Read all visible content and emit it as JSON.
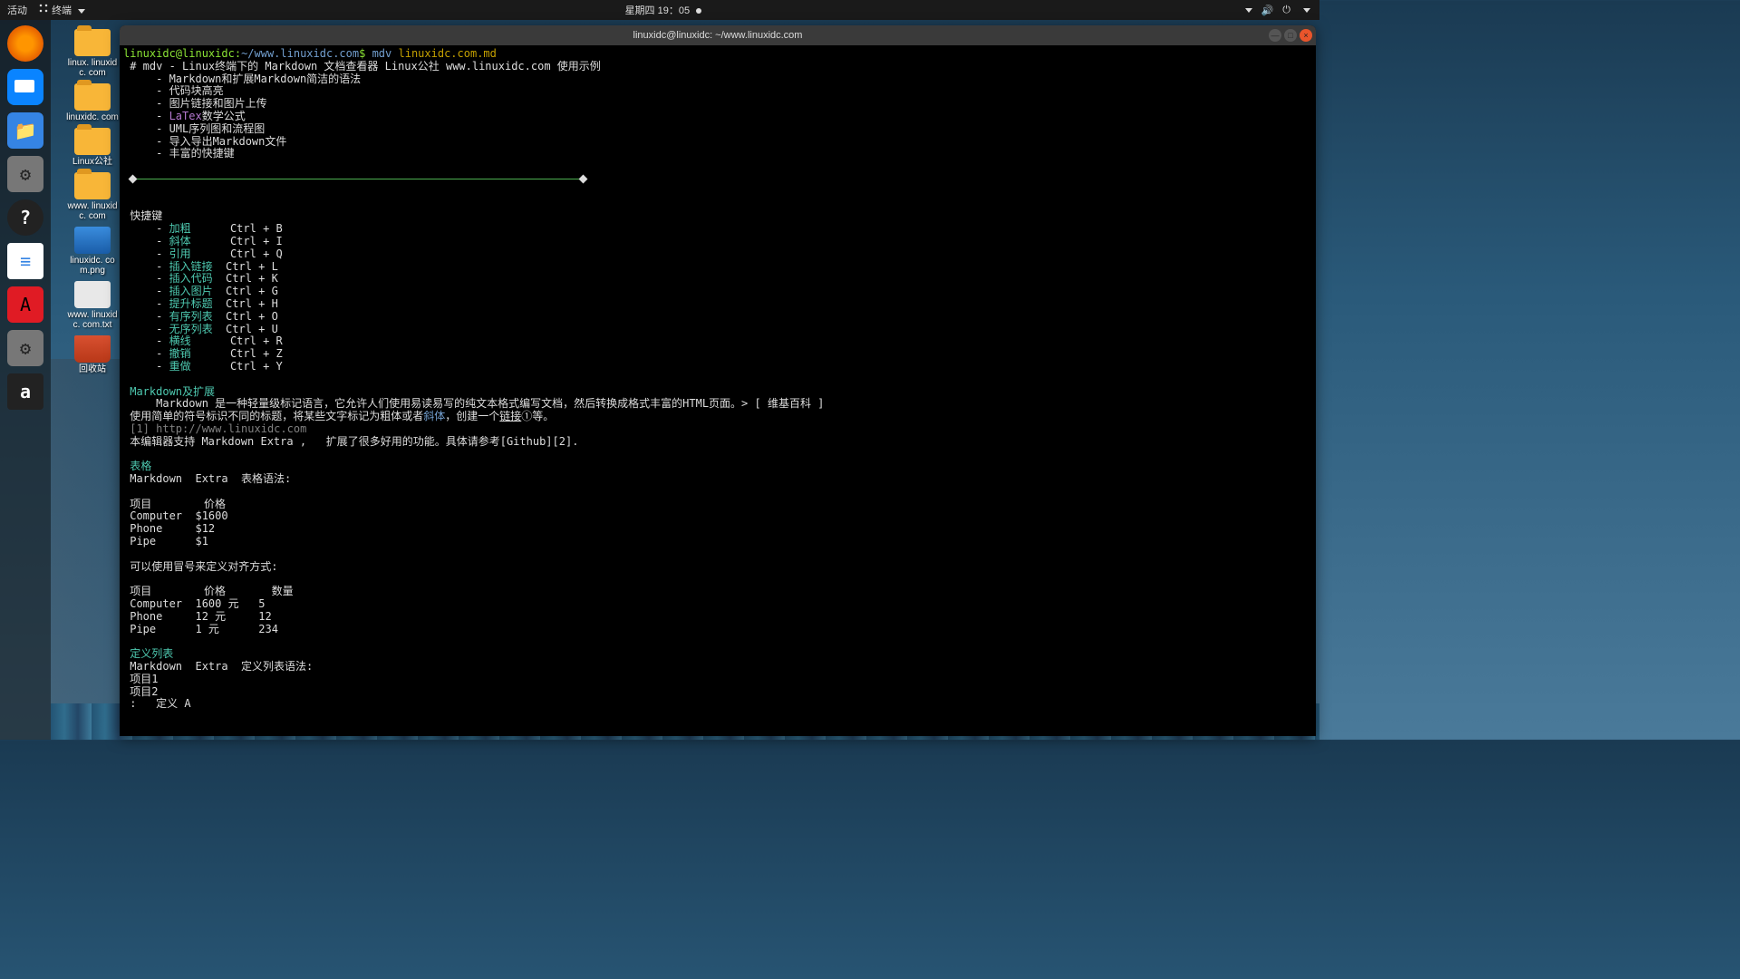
{
  "topbar": {
    "activities": "活动",
    "app_label": "终端",
    "datetime": "星期四 19：05"
  },
  "desktop_icons": [
    {
      "label": "linux.\nlinuxidc.\ncom",
      "kind": "folder"
    },
    {
      "label": "linuxidc.\ncom",
      "kind": "folder"
    },
    {
      "label": "Linux公社",
      "kind": "folder"
    },
    {
      "label": "www.\nlinuxidc.\ncom",
      "kind": "folder"
    },
    {
      "label": "linuxidc.\ncom.png",
      "kind": "png"
    },
    {
      "label": "www.\nlinuxidc.\ncom.txt",
      "kind": "txt"
    },
    {
      "label": "回收站",
      "kind": "trash"
    }
  ],
  "terminal": {
    "title": "linuxidc@linuxidc: ~/www.linuxidc.com",
    "prompt_user": "linuxidc@linuxidc",
    "prompt_sep": ":",
    "prompt_path": "~/www.linuxidc.com",
    "prompt_sym": "$",
    "command": "mdv",
    "arg": "linuxidc.com.md",
    "heading": "# mdv - Linux终端下的 Markdown 文档查看器 Linux公社 www.linuxidc.com 使用示例",
    "bullets": [
      "Markdown和扩展Markdown简洁的语法",
      "代码块高亮",
      "图片链接和图片上传",
      "LaTex数学公式",
      "UML序列图和流程图",
      "导入导出Markdown文件",
      "丰富的快捷键"
    ],
    "shortcut_title": "快捷键",
    "shortcuts": [
      {
        "name": "加粗",
        "key": "Ctrl + B"
      },
      {
        "name": "斜体",
        "key": "Ctrl + I"
      },
      {
        "name": "引用",
        "key": "Ctrl + Q"
      },
      {
        "name": "插入链接",
        "key": "Ctrl + L"
      },
      {
        "name": "插入代码",
        "key": "Ctrl + K"
      },
      {
        "name": "插入图片",
        "key": "Ctrl + G"
      },
      {
        "name": "提升标题",
        "key": "Ctrl + H"
      },
      {
        "name": "有序列表",
        "key": "Ctrl + O"
      },
      {
        "name": "无序列表",
        "key": "Ctrl + U"
      },
      {
        "name": "横线",
        "key": "Ctrl + R"
      },
      {
        "name": "撤销",
        "key": "Ctrl + Z"
      },
      {
        "name": "重做",
        "key": "Ctrl + Y"
      }
    ],
    "section_md": "Markdown及扩展",
    "md_desc": "    Markdown 是一种轻量级标记语言，它允许人们使用易读易写的纯文本格式编写文档，然后转换成格式丰富的HTML页面。> [ 维基百科 ]",
    "md_desc2_a": "使用简单的符号标识不同的标题，将某些文字标记为粗体或者",
    "md_desc2_italic": "斜体",
    "md_desc2_b": "，创建一个",
    "md_desc2_link": "链接",
    "md_desc2_c": "①等。",
    "md_ref": "[1] http://www.linuxidc.com",
    "md_extra": "本编辑器支持 Markdown Extra ,   扩展了很多好用的功能。具体请参考[Github][2].",
    "sec_table": "表格",
    "table_syntax": "Markdown  Extra  表格语法:",
    "tbl1_header": [
      "项目",
      "价格"
    ],
    "tbl1_rows": [
      [
        "Computer",
        "$1600"
      ],
      [
        "Phone",
        "$12"
      ],
      [
        "Pipe",
        "$1"
      ]
    ],
    "colon_align": "可以使用冒号来定义对齐方式:",
    "tbl2_header": [
      "项目",
      "价格",
      "数量"
    ],
    "tbl2_rows": [
      [
        "Computer",
        "1600 元",
        "5"
      ],
      [
        "Phone",
        "12 元",
        "12"
      ],
      [
        "Pipe",
        "1 元",
        "234"
      ]
    ],
    "sec_deflist": "定义列表",
    "deflist_syntax": "Markdown  Extra  定义列表语法:",
    "deflist_items": [
      "项目1",
      "项目2",
      ":   定义 A"
    ]
  }
}
